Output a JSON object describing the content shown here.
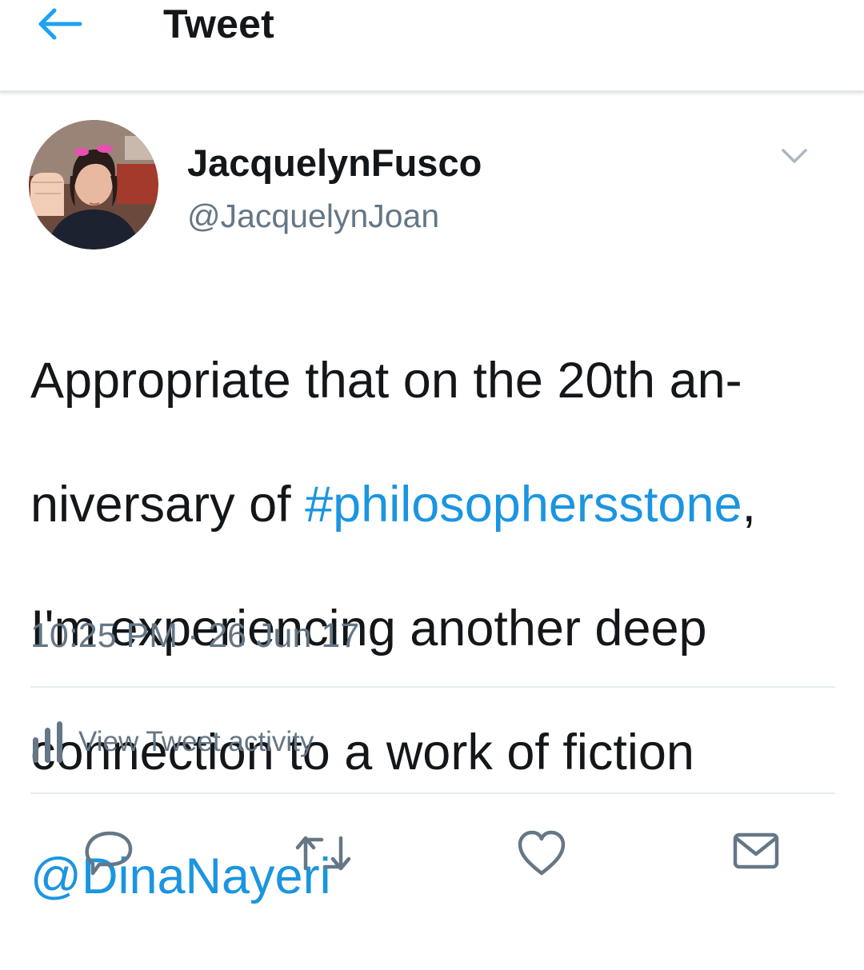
{
  "header": {
    "title": "Tweet",
    "back_icon": "arrow-left-icon",
    "accent_color": "#1da1f2"
  },
  "tweet": {
    "author": {
      "display_name": "JacquelynFusco",
      "handle": "@JacquelynJoan",
      "avatar_icon": "profile-photo"
    },
    "menu_icon": "chevron-down-icon",
    "text_lines": [
      [
        {
          "text": "Appropriate that on the 20th an-",
          "type": "text"
        }
      ],
      [
        {
          "text": "niversary of ",
          "type": "text"
        },
        {
          "text": "#philosophersstone",
          "type": "hashtag"
        },
        {
          "text": ",",
          "type": "text"
        }
      ],
      [
        {
          "text": "I'm experiencing another deep",
          "type": "text"
        }
      ],
      [
        {
          "text": "connection to a work of fiction",
          "type": "text"
        }
      ],
      [
        {
          "text": "@DinaNayeri",
          "type": "mention"
        }
      ]
    ],
    "link_color": "#1b95e0",
    "timestamp": "10:25 PM · 26 Jun 17",
    "activity": {
      "label": "View Tweet activity",
      "icon": "bar-chart-icon"
    },
    "actions": [
      {
        "name": "reply",
        "icon": "speech-bubble-icon"
      },
      {
        "name": "retweet",
        "icon": "retweet-arrows-icon"
      },
      {
        "name": "like",
        "icon": "heart-icon"
      },
      {
        "name": "direct-message",
        "icon": "envelope-icon"
      }
    ]
  }
}
